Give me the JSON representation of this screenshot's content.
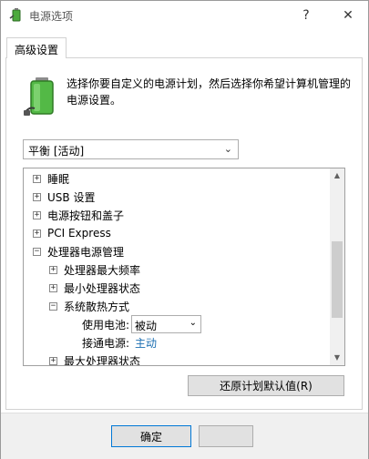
{
  "window": {
    "title": "电源选项",
    "help_glyph": "?",
    "close_glyph": "✕"
  },
  "tab": {
    "label": "高级设置"
  },
  "description": "选择你要自定义的电源计划，然后选择你希望计算机管理的电源设置。",
  "plan_combo": {
    "value": "平衡 [活动]",
    "arrow": "⌄"
  },
  "tree": {
    "items": [
      {
        "label": "睡眠",
        "expander": "+"
      },
      {
        "label": "USB 设置",
        "expander": "+"
      },
      {
        "label": "电源按钮和盖子",
        "expander": "+"
      },
      {
        "label": "PCI Express",
        "expander": "+"
      },
      {
        "label": "处理器电源管理",
        "expander": "−"
      },
      {
        "label": "处理器最大频率",
        "expander": "+"
      },
      {
        "label": "最小处理器状态",
        "expander": "+"
      },
      {
        "label": "系统散热方式",
        "expander": "−"
      },
      {
        "label": "使用电池:"
      },
      {
        "label": "接通电源:",
        "value": "主动"
      },
      {
        "label": "最大处理器状态",
        "expander": "+"
      }
    ],
    "battery_select": {
      "value": "被动",
      "arrow": "⌄"
    }
  },
  "scrollbar": {
    "up": "▲",
    "down": "▼"
  },
  "restore_button": "还原计划默认值(R)",
  "footer": {
    "ok_button": "确定"
  },
  "colors": {
    "link": "#1c6fb2",
    "accent_border": "#0078d7",
    "footer_bg": "#f0f0f0"
  }
}
